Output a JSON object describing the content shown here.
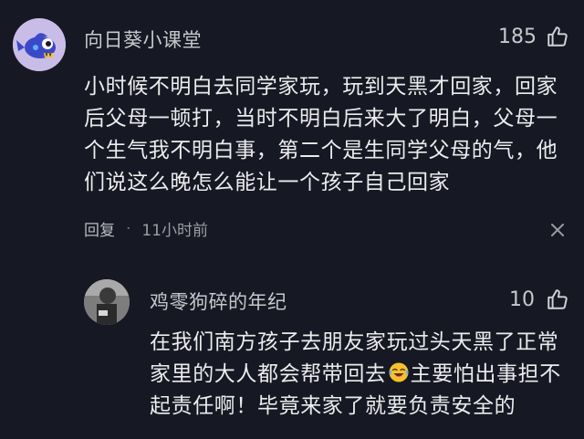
{
  "comment": {
    "username": "向日葵小课堂",
    "likes": "185",
    "text": "小时候不明白去同学家玩，玩到天黑才回家，回家后父母一顿打，当时不明白后来大了明白，父母一个生气我不明白事，第二个是生同学父母的气，他们说这么晚怎么能让一个孩子自己回家",
    "reply_label": "回复",
    "dot": "·",
    "time": "11小时前"
  },
  "reply": {
    "username": "鸡零狗碎的年纪",
    "likes": "10",
    "text_before_emoji": "在我们南方孩子去朋友家玩过头天黑了正常家里的大人都会帮带回去",
    "emoji_name": "laughing-crying-emoji",
    "text_after_emoji": "主要怕出事担不起责任啊！毕竟来家了就要负责安全的"
  },
  "colors": {
    "background": "#161823",
    "text_primary": "#ececee",
    "text_secondary": "#c7c7cc",
    "text_muted": "#9d9da5",
    "avatar_bg": "#c9bde8"
  },
  "icons": {
    "like": "thumb-up-icon",
    "close": "close-icon"
  }
}
